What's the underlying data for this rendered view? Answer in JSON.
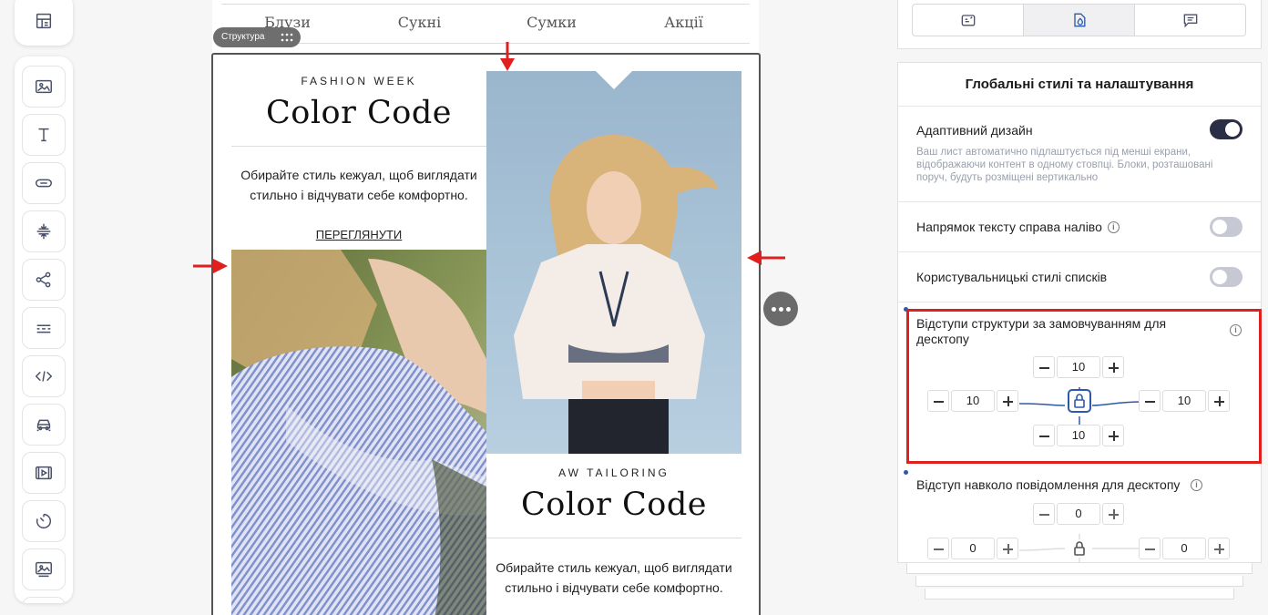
{
  "menu": [
    "Блузи",
    "Сукні",
    "Сумки",
    "Акції"
  ],
  "structure_tag": "Структура",
  "email": {
    "left": {
      "kicker": "FASHION WEEK",
      "headline": "Color Code",
      "body": "Обирайте стиль кежуал, щоб виглядати стильно і відчувати себе комфортно.",
      "link": "ПЕРЕГЛЯНУТИ"
    },
    "right": {
      "kicker": "AW TAILORING",
      "headline": "Color Code",
      "body": "Обирайте стиль кежуал, щоб виглядати стильно і відчувати себе комфортно."
    }
  },
  "tools": [
    "template-icon",
    "image-icon",
    "text-icon",
    "button-icon",
    "spacer-icon",
    "social-icon",
    "divider-icon",
    "html-icon",
    "car-icon",
    "video-icon",
    "timer-icon",
    "banner-icon"
  ],
  "panel": {
    "tabs": [
      "content-tab-icon",
      "styles-tab-icon",
      "comments-tab-icon"
    ],
    "title": "Глобальні стилі та налаштування",
    "adaptive": {
      "label": "Адаптивний дизайн",
      "on": true,
      "desc": "Ваш лист автоматично підлаштується під менші екрани, відображаючи контент в одному стовпці. Блоки, розташовані поруч, будуть розміщені вертикально"
    },
    "rtl": {
      "label": "Напрямок тексту справа наліво",
      "on": false
    },
    "lists": {
      "label": "Користувальницькі стилі списків",
      "on": false
    },
    "structure_padding": {
      "label": "Відступи структури за замовчуванням для десктопу",
      "top": "10",
      "left": "10",
      "right": "10",
      "bottom": "10"
    },
    "message_padding": {
      "label": "Відступ навколо повідомлення для десктопу",
      "top": "0",
      "left": "0",
      "right": "0"
    }
  },
  "colors": {
    "accent": "#2d5aa8",
    "highlight": "#e01f1f",
    "toggle_on": "#2b2f45"
  }
}
